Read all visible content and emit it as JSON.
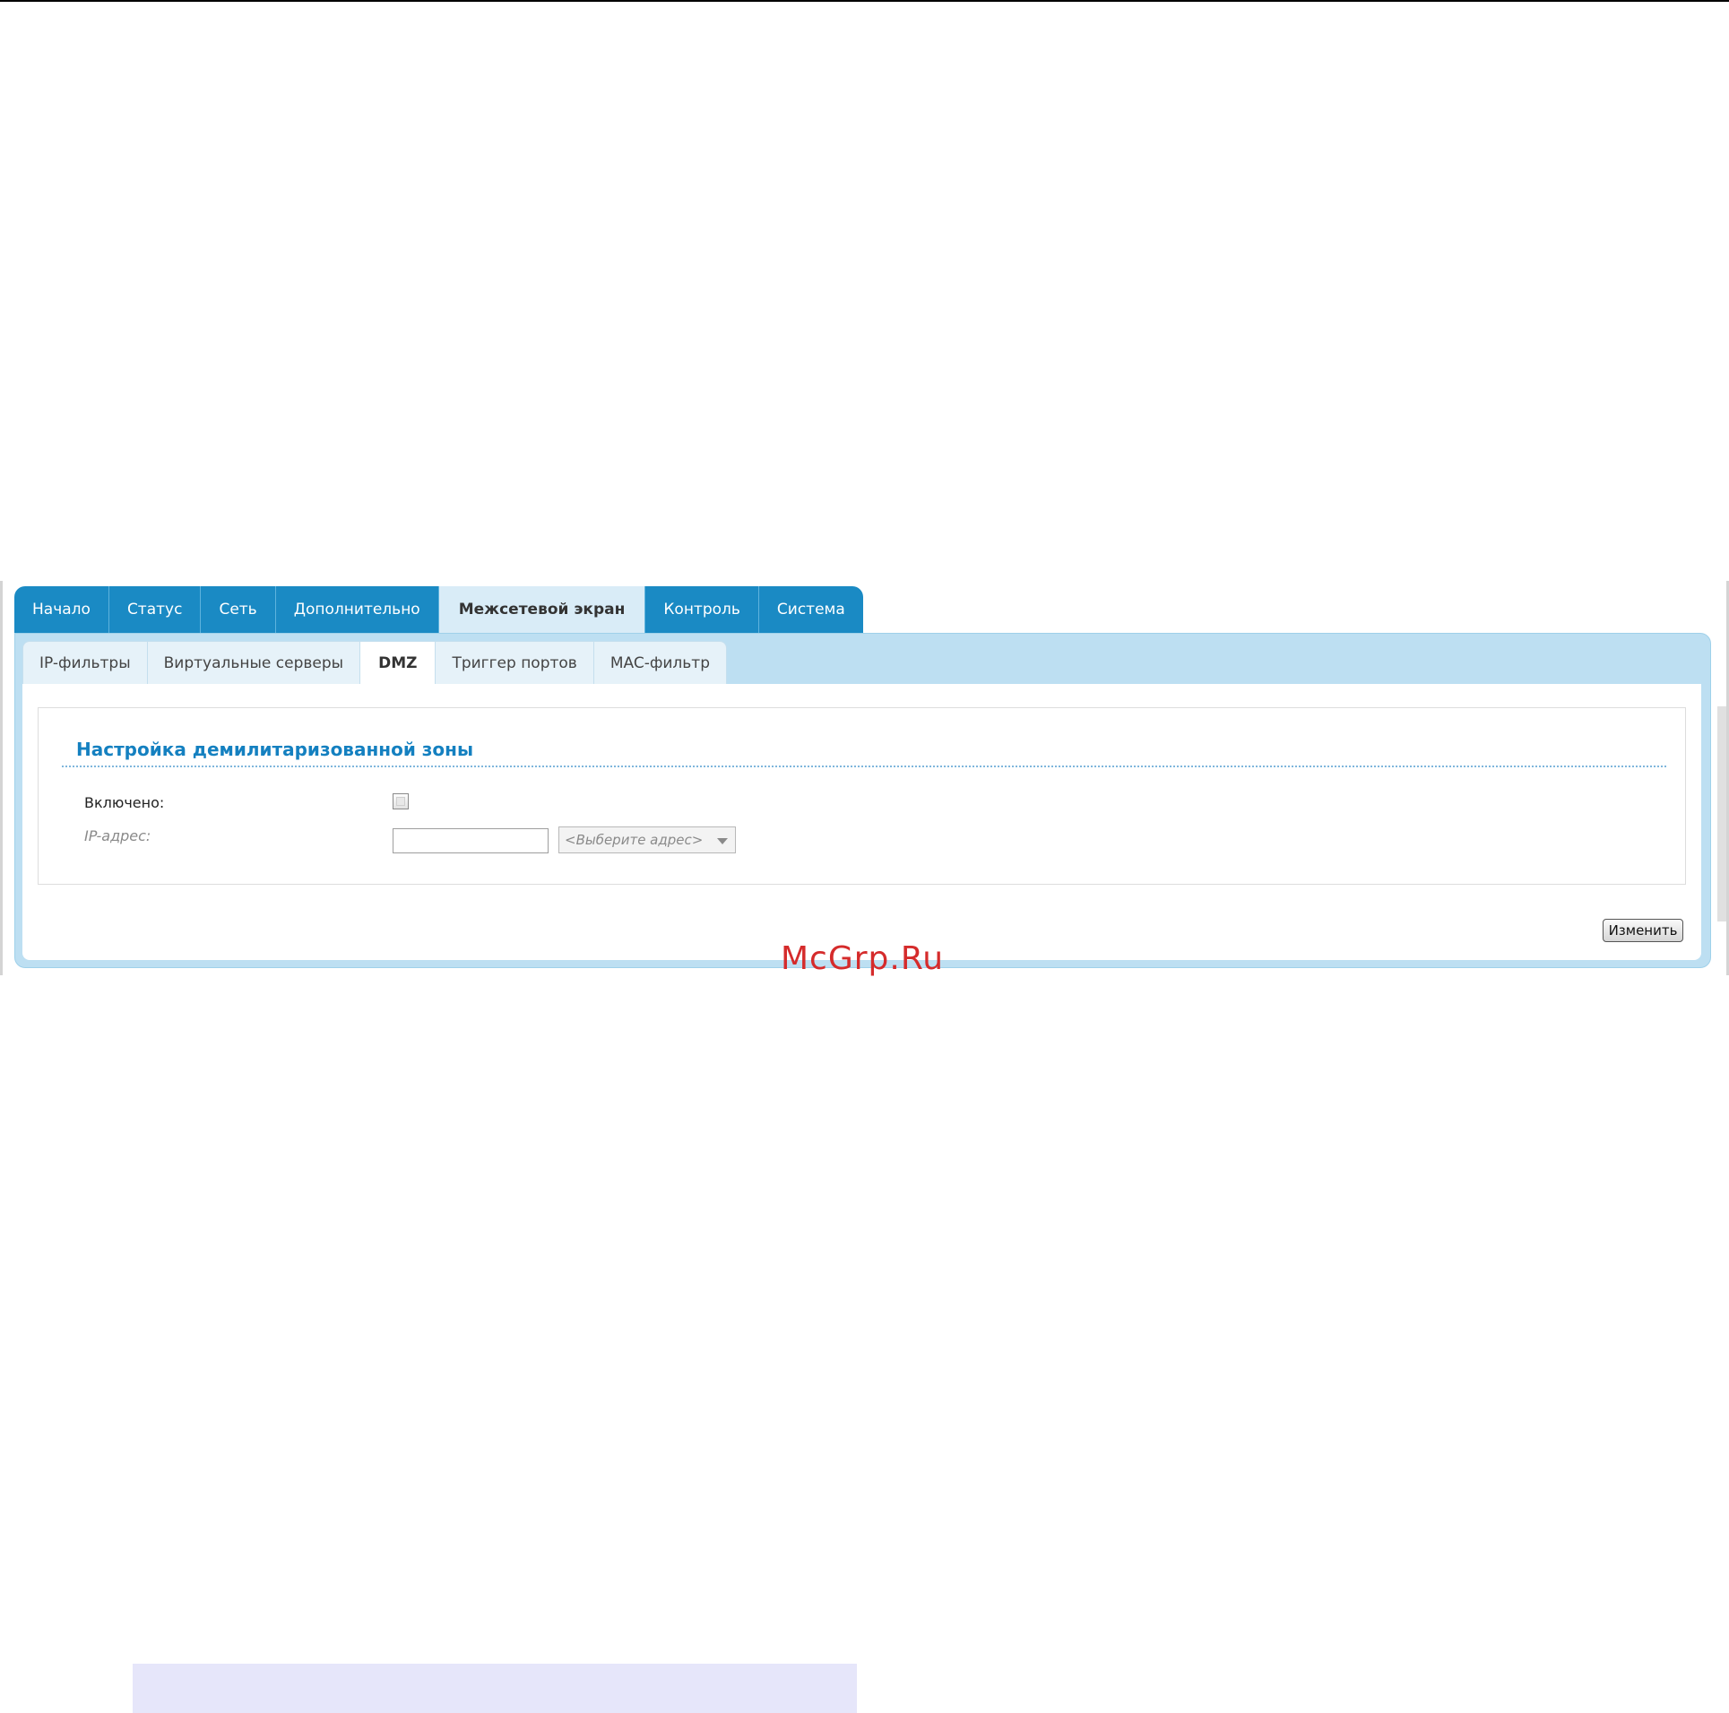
{
  "main_tabs": [
    {
      "label": "Начало"
    },
    {
      "label": "Статус"
    },
    {
      "label": "Сеть"
    },
    {
      "label": "Дополнительно"
    },
    {
      "label": "Межсетевой экран"
    },
    {
      "label": "Контроль"
    },
    {
      "label": "Система"
    }
  ],
  "main_tab_active": "Межсетевой экран",
  "sub_tabs": [
    {
      "label": "IP-фильтры"
    },
    {
      "label": "Виртуальные серверы"
    },
    {
      "label": "DMZ"
    },
    {
      "label": "Триггер портов"
    },
    {
      "label": "MAC-фильтр"
    }
  ],
  "sub_tab_active": "DMZ",
  "section": {
    "title": "Настройка демилитаризованной зоны",
    "enabled_label": "Включено:",
    "enabled_checked": false,
    "ip_label": "IP-адрес:",
    "ip_value": "",
    "address_select_value": "<Выберите адрес>"
  },
  "apply_label": "Изменить",
  "watermark": "McGrp.Ru",
  "colors": {
    "tab_blue": "#1a8ac4",
    "panel_blue": "#bddff2",
    "title_blue": "#1480c0",
    "watermark_red": "#d52b2b"
  }
}
